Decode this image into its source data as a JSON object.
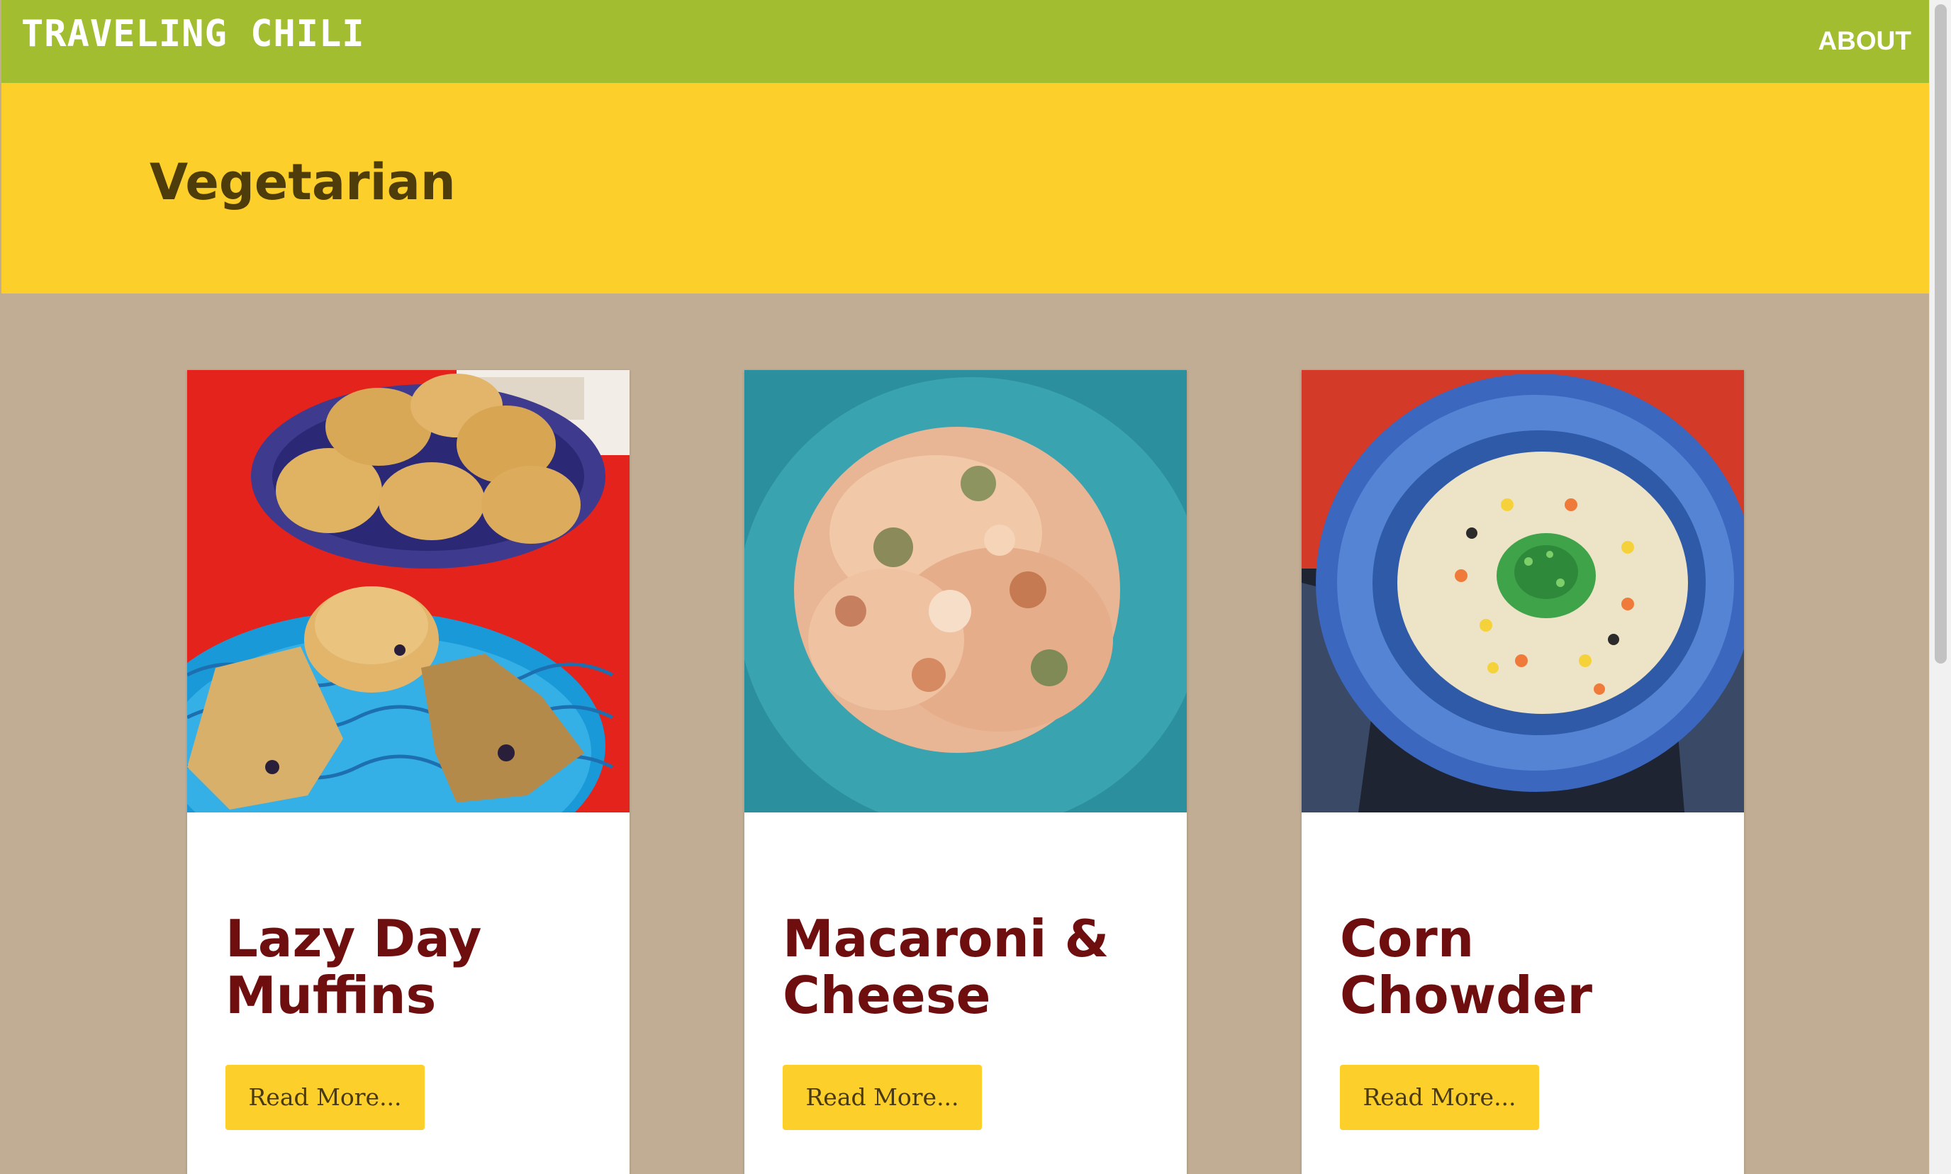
{
  "header": {
    "site_title": "TRAVELING CHILI",
    "nav": {
      "about_label": "ABOUT"
    }
  },
  "banner": {
    "title": "Vegetarian"
  },
  "posts": [
    {
      "title": "Lazy Day Muffins",
      "button_label": "Read More...",
      "image_icon": "muffins-photo"
    },
    {
      "title": "Macaroni & Cheese",
      "button_label": "Read More...",
      "image_icon": "macaroni-photo"
    },
    {
      "title": "Corn Chowder",
      "button_label": "Read More...",
      "image_icon": "corn-chowder-photo"
    }
  ],
  "colors": {
    "header_bg": "#a2bd30",
    "banner_bg": "#fdcf2b",
    "page_bg": "#c1ad94",
    "title_color": "#6f0e0e",
    "button_bg": "#fdcf2b"
  }
}
